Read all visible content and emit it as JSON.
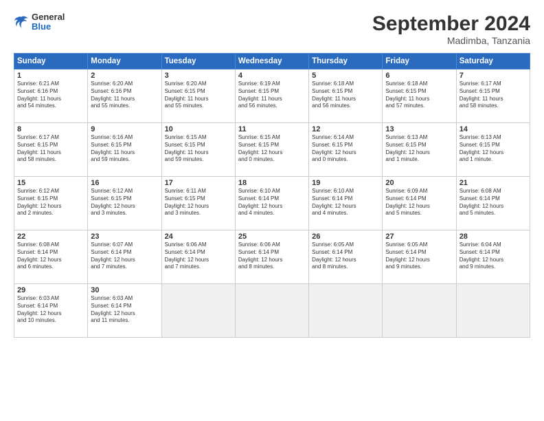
{
  "header": {
    "logo_general": "General",
    "logo_blue": "Blue",
    "month": "September 2024",
    "location": "Madimba, Tanzania"
  },
  "days_of_week": [
    "Sunday",
    "Monday",
    "Tuesday",
    "Wednesday",
    "Thursday",
    "Friday",
    "Saturday"
  ],
  "weeks": [
    [
      {
        "day": "1",
        "info": "Sunrise: 6:21 AM\nSunset: 6:16 PM\nDaylight: 11 hours\nand 54 minutes."
      },
      {
        "day": "2",
        "info": "Sunrise: 6:20 AM\nSunset: 6:16 PM\nDaylight: 11 hours\nand 55 minutes."
      },
      {
        "day": "3",
        "info": "Sunrise: 6:20 AM\nSunset: 6:15 PM\nDaylight: 11 hours\nand 55 minutes."
      },
      {
        "day": "4",
        "info": "Sunrise: 6:19 AM\nSunset: 6:15 PM\nDaylight: 11 hours\nand 56 minutes."
      },
      {
        "day": "5",
        "info": "Sunrise: 6:18 AM\nSunset: 6:15 PM\nDaylight: 11 hours\nand 56 minutes."
      },
      {
        "day": "6",
        "info": "Sunrise: 6:18 AM\nSunset: 6:15 PM\nDaylight: 11 hours\nand 57 minutes."
      },
      {
        "day": "7",
        "info": "Sunrise: 6:17 AM\nSunset: 6:15 PM\nDaylight: 11 hours\nand 58 minutes."
      }
    ],
    [
      {
        "day": "8",
        "info": "Sunrise: 6:17 AM\nSunset: 6:15 PM\nDaylight: 11 hours\nand 58 minutes."
      },
      {
        "day": "9",
        "info": "Sunrise: 6:16 AM\nSunset: 6:15 PM\nDaylight: 11 hours\nand 59 minutes."
      },
      {
        "day": "10",
        "info": "Sunrise: 6:15 AM\nSunset: 6:15 PM\nDaylight: 11 hours\nand 59 minutes."
      },
      {
        "day": "11",
        "info": "Sunrise: 6:15 AM\nSunset: 6:15 PM\nDaylight: 12 hours\nand 0 minutes."
      },
      {
        "day": "12",
        "info": "Sunrise: 6:14 AM\nSunset: 6:15 PM\nDaylight: 12 hours\nand 0 minutes."
      },
      {
        "day": "13",
        "info": "Sunrise: 6:13 AM\nSunset: 6:15 PM\nDaylight: 12 hours\nand 1 minute."
      },
      {
        "day": "14",
        "info": "Sunrise: 6:13 AM\nSunset: 6:15 PM\nDaylight: 12 hours\nand 1 minute."
      }
    ],
    [
      {
        "day": "15",
        "info": "Sunrise: 6:12 AM\nSunset: 6:15 PM\nDaylight: 12 hours\nand 2 minutes."
      },
      {
        "day": "16",
        "info": "Sunrise: 6:12 AM\nSunset: 6:15 PM\nDaylight: 12 hours\nand 3 minutes."
      },
      {
        "day": "17",
        "info": "Sunrise: 6:11 AM\nSunset: 6:15 PM\nDaylight: 12 hours\nand 3 minutes."
      },
      {
        "day": "18",
        "info": "Sunrise: 6:10 AM\nSunset: 6:14 PM\nDaylight: 12 hours\nand 4 minutes."
      },
      {
        "day": "19",
        "info": "Sunrise: 6:10 AM\nSunset: 6:14 PM\nDaylight: 12 hours\nand 4 minutes."
      },
      {
        "day": "20",
        "info": "Sunrise: 6:09 AM\nSunset: 6:14 PM\nDaylight: 12 hours\nand 5 minutes."
      },
      {
        "day": "21",
        "info": "Sunrise: 6:08 AM\nSunset: 6:14 PM\nDaylight: 12 hours\nand 5 minutes."
      }
    ],
    [
      {
        "day": "22",
        "info": "Sunrise: 6:08 AM\nSunset: 6:14 PM\nDaylight: 12 hours\nand 6 minutes."
      },
      {
        "day": "23",
        "info": "Sunrise: 6:07 AM\nSunset: 6:14 PM\nDaylight: 12 hours\nand 7 minutes."
      },
      {
        "day": "24",
        "info": "Sunrise: 6:06 AM\nSunset: 6:14 PM\nDaylight: 12 hours\nand 7 minutes."
      },
      {
        "day": "25",
        "info": "Sunrise: 6:06 AM\nSunset: 6:14 PM\nDaylight: 12 hours\nand 8 minutes."
      },
      {
        "day": "26",
        "info": "Sunrise: 6:05 AM\nSunset: 6:14 PM\nDaylight: 12 hours\nand 8 minutes."
      },
      {
        "day": "27",
        "info": "Sunrise: 6:05 AM\nSunset: 6:14 PM\nDaylight: 12 hours\nand 9 minutes."
      },
      {
        "day": "28",
        "info": "Sunrise: 6:04 AM\nSunset: 6:14 PM\nDaylight: 12 hours\nand 9 minutes."
      }
    ],
    [
      {
        "day": "29",
        "info": "Sunrise: 6:03 AM\nSunset: 6:14 PM\nDaylight: 12 hours\nand 10 minutes."
      },
      {
        "day": "30",
        "info": "Sunrise: 6:03 AM\nSunset: 6:14 PM\nDaylight: 12 hours\nand 11 minutes."
      },
      {
        "day": "",
        "info": ""
      },
      {
        "day": "",
        "info": ""
      },
      {
        "day": "",
        "info": ""
      },
      {
        "day": "",
        "info": ""
      },
      {
        "day": "",
        "info": ""
      }
    ]
  ]
}
